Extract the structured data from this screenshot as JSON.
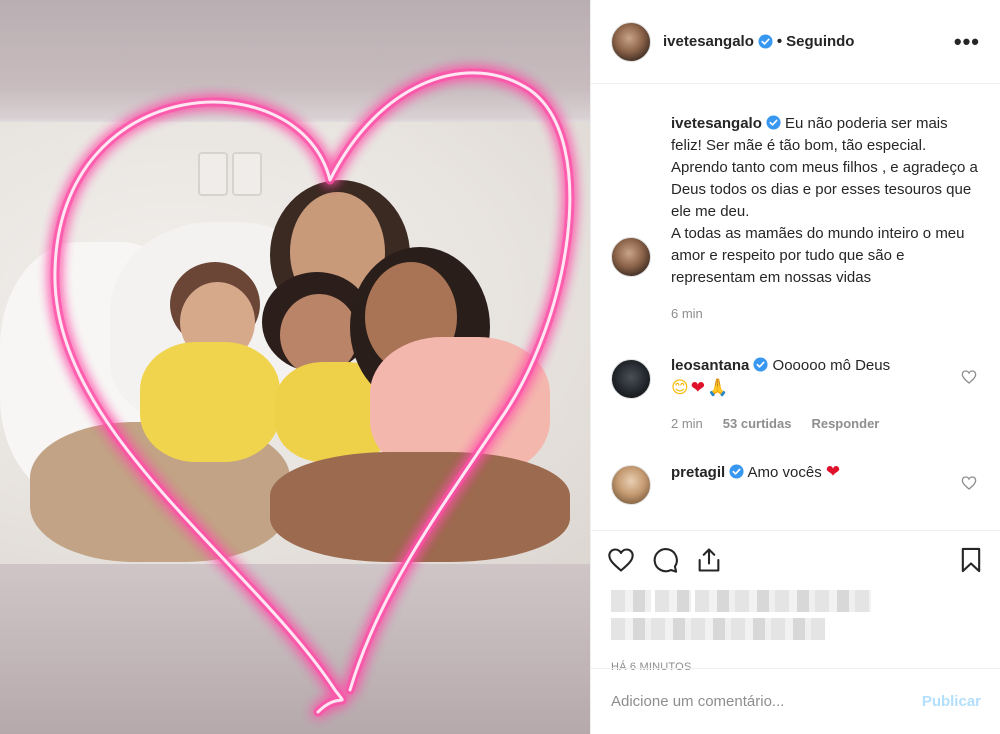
{
  "post": {
    "username": "ivetesangalo",
    "following_label": "Seguindo",
    "more_icon": "more-horizontal-icon"
  },
  "caption": {
    "username": "ivetesangalo",
    "text": "Eu não poderia ser mais feliz! Ser mãe é tão bom, tão especial. Aprendo tanto com meus filhos , e agradeço a Deus todos os dias e por esses tesouros que ele me deu.\nA todas as mamães do mundo inteiro o meu amor e respeito por tudo que são e representam em nossas vidas",
    "time": "6 min"
  },
  "comments": [
    {
      "username": "leosantana",
      "text": "Oooooo mô Deus",
      "emojis": [
        "😊",
        "❤",
        "🙏"
      ],
      "time": "2 min",
      "likes": "53 curtidas",
      "reply_label": "Responder"
    },
    {
      "username": "pretagil",
      "text": "Amo vocês",
      "emoji": "❤"
    }
  ],
  "actions": {
    "like_icon": "heart-outline-icon",
    "comment_icon": "speech-bubble-icon",
    "share_icon": "share-icon",
    "save_icon": "bookmark-icon"
  },
  "post_time": "HÁ 6 MINUTOS",
  "add_comment": {
    "placeholder": "Adicione um comentário...",
    "publish_label": "Publicar"
  },
  "colors": {
    "verified_blue": "#3897f0",
    "neon_pink": "#ff4fa8",
    "publish_disabled": "#b2dffc"
  }
}
